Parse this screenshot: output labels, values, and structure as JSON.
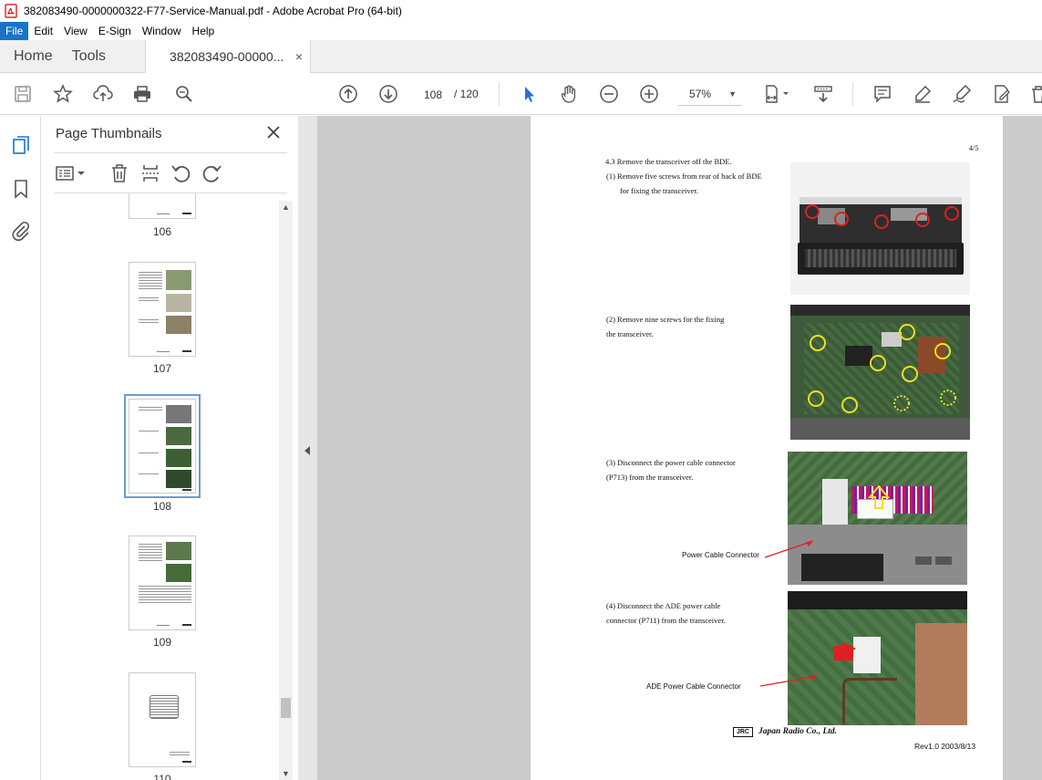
{
  "window": {
    "title": "382083490-0000000322-F77-Service-Manual.pdf - Adobe Acrobat Pro (64-bit)"
  },
  "menu": [
    "File",
    "Edit",
    "View",
    "E-Sign",
    "Window",
    "Help"
  ],
  "tabs": {
    "home": "Home",
    "tools": "Tools",
    "document": "382083490-00000...",
    "close": "×"
  },
  "toolbar": {
    "page_current": "108",
    "page_total": "/ 120",
    "zoom": "57%"
  },
  "thumbnails_panel": {
    "title": "Page Thumbnails",
    "pages": [
      {
        "label": "106"
      },
      {
        "label": "107"
      },
      {
        "label": "108"
      },
      {
        "label": "109"
      },
      {
        "label": "110"
      }
    ]
  },
  "page": {
    "page_number": "4/5",
    "step_heading": "4.3    Remove the transceiver off the BDE.",
    "step1_line1": "(1)  Remove  five  screws  from  rear  of  back  of  BDE",
    "step1_line2": "for fixing the transceiver.",
    "step2_line1": "(2) Remove nine screws for the fixing",
    "step2_line2": "the transceiver.",
    "step3_line1": "(3) Disconnect the power cable connector",
    "step3_line2": "(P713) from the transceiver.",
    "step3_callout": "Power Cable Connector",
    "step4_line1": "(4) Disconnect the ADE power cable",
    "step4_line2": "connector (P711) from the transceiver.",
    "step4_callout": "ADE Power Cable Connector",
    "logo_text": "JRC",
    "company": "Japan Radio Co., Ltd.",
    "revision": "Rev1.0 2003/8/13"
  },
  "colors": {
    "accent": "#1a73c7",
    "annotation_red": "#e02020",
    "annotation_yellow": "#f0e020"
  }
}
